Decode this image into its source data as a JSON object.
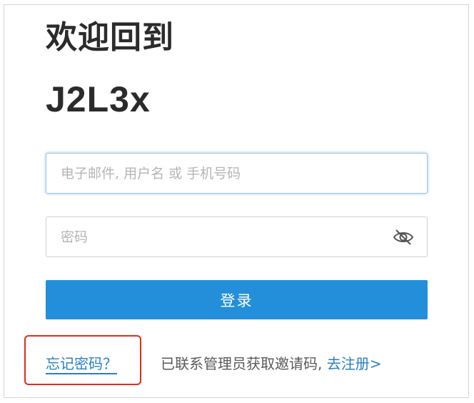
{
  "header": {
    "welcome": "欢迎回到",
    "brand": "J2L3x"
  },
  "form": {
    "identifier_placeholder": "电子邮件, 用户名 或 手机号码",
    "identifier_value": "",
    "password_placeholder": "密码",
    "password_value": "",
    "password_toggle_icon": "eye-slash-icon",
    "login_label": "登录"
  },
  "footer": {
    "forgot_password": "忘记密码？",
    "invite_text": "已联系管理员获取邀请码,",
    "register_link": "去注册>"
  },
  "colors": {
    "primary": "#238fdb",
    "link": "#2a7fc6",
    "highlight": "#e02d1b",
    "heading": "#2b2b2b"
  }
}
